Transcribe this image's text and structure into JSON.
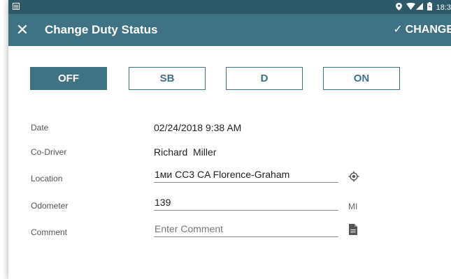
{
  "status_bar": {
    "time": "18:3",
    "icons": [
      "notification-icon",
      "location-icon",
      "wifi-icon",
      "signal-icon",
      "battery-icon"
    ]
  },
  "app_bar": {
    "title": "Change Duty Status",
    "action_label": "CHANGE"
  },
  "duty_status": {
    "options": [
      "OFF",
      "SB",
      "D",
      "ON"
    ],
    "selected": "OFF"
  },
  "form": {
    "date": {
      "label": "Date",
      "value": "02/24/2018 9:38 AM"
    },
    "co_driver": {
      "label": "Co-Driver",
      "value": "Richard  Miller"
    },
    "location": {
      "label": "Location",
      "value": "1ми CC3 CA Florence-Graham"
    },
    "odometer": {
      "label": "Odometer",
      "value": "139",
      "unit": "MI"
    },
    "comment": {
      "label": "Comment",
      "value": "",
      "placeholder": "Enter Comment"
    }
  },
  "colors": {
    "status_bar": "#2e5968",
    "app_bar": "#3f7282",
    "accent": "#3f7282"
  }
}
